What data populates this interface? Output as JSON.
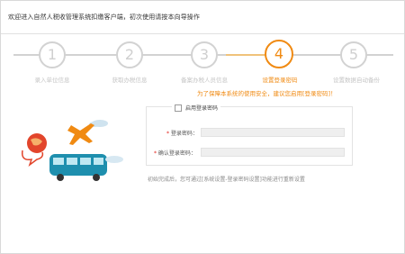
{
  "window": {
    "title": "欢迎进入自然人税收管理系统扣缴客户端，初次使用请按本向导操作"
  },
  "stepper": {
    "steps": [
      {
        "number": "1",
        "label": "录入单位信息",
        "active": false
      },
      {
        "number": "2",
        "label": "获取办税信息",
        "active": false
      },
      {
        "number": "3",
        "label": "备案办税人员信息",
        "active": false
      },
      {
        "number": "4",
        "label": "设置登录密码",
        "active": true
      },
      {
        "number": "5",
        "label": "设置数据自动备份",
        "active": false
      }
    ],
    "active_color": "#f08a12",
    "inactive_color": "#d2d2d2"
  },
  "notice": "为了保障本系统的使用安全，建议您启用[登录密码]！",
  "form": {
    "enable_label": "启用登录密码",
    "enable_checked": false,
    "password_label": "登录密码：",
    "confirm_label": "确认登录密码：",
    "password_value": "",
    "confirm_value": ""
  },
  "tip": "初始完成后，您可通过[系统设置-登录密码设置]功能进行重新设置"
}
